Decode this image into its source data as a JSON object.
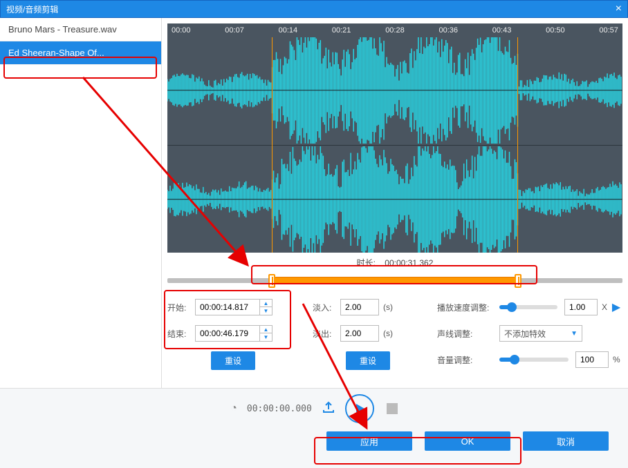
{
  "title": "视频/音频剪辑",
  "files": {
    "items": [
      {
        "label": "Bruno Mars - Treasure.wav"
      },
      {
        "label": "Ed Sheeran-Shape Of..."
      }
    ]
  },
  "timeline": {
    "ticks": [
      "00:00",
      "00:07",
      "00:14",
      "00:21",
      "00:28",
      "00:36",
      "00:43",
      "00:50",
      "00:57"
    ]
  },
  "duration": {
    "label": "时长:",
    "value": "00:00:31.362"
  },
  "range": {
    "start_pct": 23,
    "end_pct": 77
  },
  "trim": {
    "start_label": "开始:",
    "start_value": "00:00:14.817",
    "end_label": "结束:",
    "end_value": "00:00:46.179",
    "reset": "重设"
  },
  "fade": {
    "in_label": "淡入:",
    "in_value": "2.00",
    "out_label": "淡出:",
    "out_value": "2.00",
    "unit": "(s)",
    "reset": "重设"
  },
  "adjust": {
    "speed_label": "播放速度调整:",
    "speed_value": "1.00",
    "speed_unit": "X",
    "voice_label": "声线调整:",
    "voice_value": "不添加特效",
    "volume_label": "音量调整:",
    "volume_value": "100",
    "volume_unit": "%"
  },
  "player": {
    "time": "00:00:00.000"
  },
  "buttons": {
    "apply": "应用",
    "ok": "OK",
    "cancel": "取消"
  }
}
